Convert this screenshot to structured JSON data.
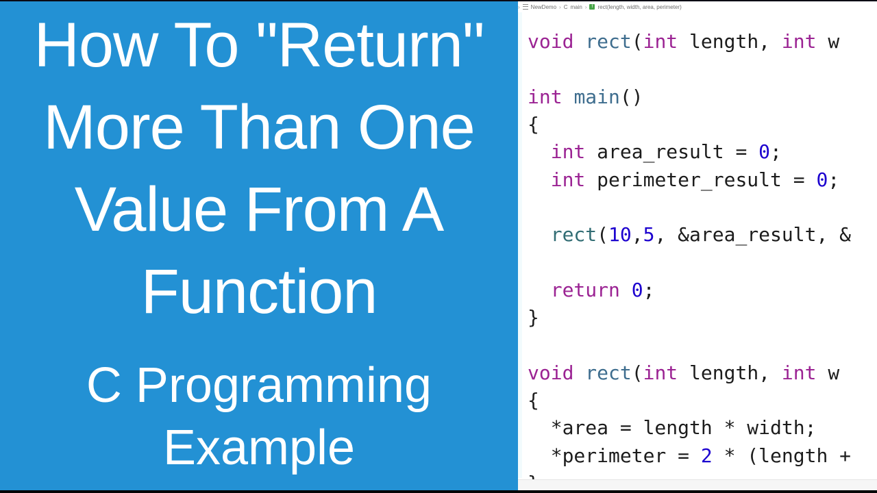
{
  "thumbnail": {
    "title_lines": [
      "How To \"Return\"",
      "More Than One",
      "Value From A",
      "Function"
    ],
    "subtitle_lines": [
      "C Programming",
      "Example"
    ],
    "background_color": "#2391d4",
    "text_color": "#ffffff"
  },
  "editor": {
    "breadcrumb": {
      "items": [
        {
          "icon": "folder-icon",
          "label": "NewDemo"
        },
        {
          "icon": "c-file-icon",
          "label": "C"
        },
        {
          "icon": "",
          "label": "main"
        },
        {
          "icon": "function-icon",
          "label": "rect(length, width, area, perimeter)"
        }
      ]
    },
    "code_lines": [
      [
        {
          "t": "void",
          "c": "kw"
        },
        {
          "t": " "
        },
        {
          "t": "rect",
          "c": "fn2"
        },
        {
          "t": "("
        },
        {
          "t": "int",
          "c": "kw"
        },
        {
          "t": " length, "
        },
        {
          "t": "int",
          "c": "kw"
        },
        {
          "t": " w"
        }
      ],
      [],
      [
        {
          "t": "int",
          "c": "kw"
        },
        {
          "t": " "
        },
        {
          "t": "main",
          "c": "fn2"
        },
        {
          "t": "()"
        }
      ],
      [
        {
          "t": "{"
        }
      ],
      [
        {
          "t": "  "
        },
        {
          "t": "int",
          "c": "kw"
        },
        {
          "t": " area_result = "
        },
        {
          "t": "0",
          "c": "num"
        },
        {
          "t": ";"
        }
      ],
      [
        {
          "t": "  "
        },
        {
          "t": "int",
          "c": "kw"
        },
        {
          "t": " perimeter_result = "
        },
        {
          "t": "0",
          "c": "num"
        },
        {
          "t": ";"
        }
      ],
      [],
      [
        {
          "t": "  "
        },
        {
          "t": "rect",
          "c": "fn"
        },
        {
          "t": "("
        },
        {
          "t": "10",
          "c": "num"
        },
        {
          "t": ","
        },
        {
          "t": "5",
          "c": "num"
        },
        {
          "t": ", &area_result, &"
        }
      ],
      [],
      [
        {
          "t": "  "
        },
        {
          "t": "return",
          "c": "kw"
        },
        {
          "t": " "
        },
        {
          "t": "0",
          "c": "num"
        },
        {
          "t": ";"
        }
      ],
      [
        {
          "t": "}"
        }
      ],
      [],
      [
        {
          "t": "void",
          "c": "kw"
        },
        {
          "t": " "
        },
        {
          "t": "rect",
          "c": "fn2"
        },
        {
          "t": "("
        },
        {
          "t": "int",
          "c": "kw"
        },
        {
          "t": " length, "
        },
        {
          "t": "int",
          "c": "kw"
        },
        {
          "t": " w"
        }
      ],
      [
        {
          "t": "{"
        }
      ],
      [
        {
          "t": "  *area = length * width;"
        }
      ],
      [
        {
          "t": "  *perimeter = "
        },
        {
          "t": "2",
          "c": "num"
        },
        {
          "t": " * (length +"
        }
      ],
      [
        {
          "t": "}"
        }
      ]
    ],
    "colors": {
      "keyword": "#9b2393",
      "function": "#326d74",
      "number": "#1c00cf",
      "plain": "#1c1c1c"
    }
  }
}
